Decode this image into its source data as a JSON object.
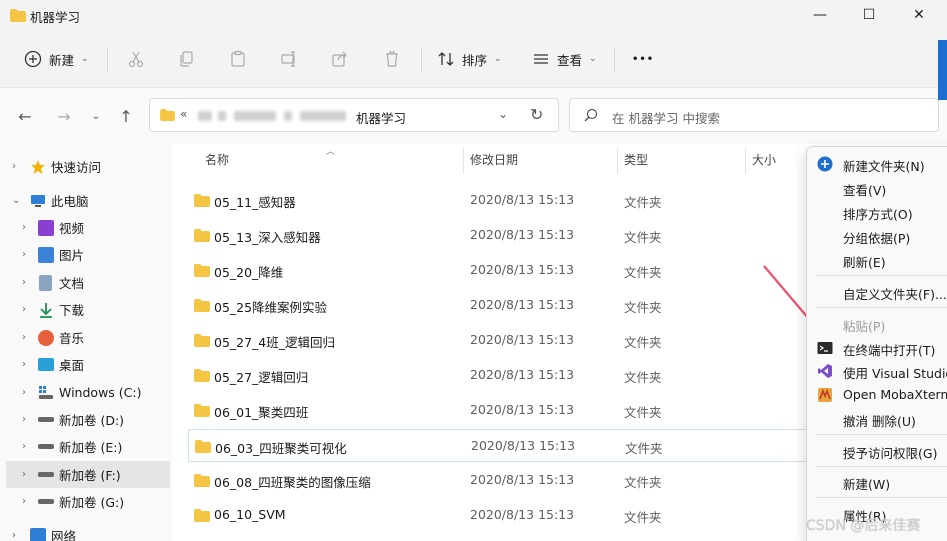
{
  "window": {
    "title": "机器学习",
    "controls": {
      "minimize": "—",
      "maximize": "☐",
      "close": "✕"
    }
  },
  "toolbar": {
    "new_label": "新建",
    "sort_label": "排序",
    "view_label": "查看",
    "more_label": "•••"
  },
  "address": {
    "prefix": "«",
    "current": "机器学习",
    "search_placeholder": "在 机器学习 中搜索"
  },
  "sidebar": {
    "items": [
      {
        "label": "快速访问",
        "icon": "star-icon"
      },
      {
        "label": "此电脑",
        "icon": "computer-icon"
      },
      {
        "label": "视频",
        "icon": "video-icon"
      },
      {
        "label": "图片",
        "icon": "picture-icon"
      },
      {
        "label": "文档",
        "icon": "document-icon"
      },
      {
        "label": "下载",
        "icon": "download-icon"
      },
      {
        "label": "音乐",
        "icon": "music-icon"
      },
      {
        "label": "桌面",
        "icon": "desktop-icon"
      },
      {
        "label": "Windows (C:)",
        "icon": "drive-c-icon"
      },
      {
        "label": "新加卷 (D:)",
        "icon": "drive-icon"
      },
      {
        "label": "新加卷 (E:)",
        "icon": "drive-icon"
      },
      {
        "label": "新加卷 (F:)",
        "icon": "drive-icon"
      },
      {
        "label": "新加卷 (G:)",
        "icon": "drive-icon"
      },
      {
        "label": "网络",
        "icon": "network-icon"
      }
    ]
  },
  "columns": {
    "name": "名称",
    "date": "修改日期",
    "type": "类型",
    "size": "大小"
  },
  "files": [
    {
      "name": "05_11_感知器",
      "date": "2020/8/13 15:13",
      "type": "文件夹"
    },
    {
      "name": "05_13_深入感知器",
      "date": "2020/8/13 15:13",
      "type": "文件夹"
    },
    {
      "name": "05_20_降维",
      "date": "2020/8/13 15:13",
      "type": "文件夹"
    },
    {
      "name": "05_25降维案例实验",
      "date": "2020/8/13 15:13",
      "type": "文件夹"
    },
    {
      "name": "05_27_4班_逻辑回归",
      "date": "2020/8/13 15:13",
      "type": "文件夹"
    },
    {
      "name": "05_27_逻辑回归",
      "date": "2020/8/13 15:13",
      "type": "文件夹"
    },
    {
      "name": "06_01_聚类四班",
      "date": "2020/8/13 15:13",
      "type": "文件夹"
    },
    {
      "name": "06_03_四班聚类可视化",
      "date": "2020/8/13 15:13",
      "type": "文件夹"
    },
    {
      "name": "06_08_四班聚类的图像压缩",
      "date": "2020/8/13 15:13",
      "type": "文件夹"
    },
    {
      "name": "06_10_SVM",
      "date": "2020/8/13 15:13",
      "type": "文件夹"
    }
  ],
  "context_menu": {
    "items": [
      {
        "label": "新建文件夹(N)",
        "icon": "new-folder-icon"
      },
      {
        "label": "查看(V)"
      },
      {
        "label": "排序方式(O)"
      },
      {
        "label": "分组依据(P)"
      },
      {
        "label": "刷新(E)"
      },
      {
        "label": "自定义文件夹(F)..."
      },
      {
        "label": "粘贴(P)"
      },
      {
        "label": "在终端中打开(T)",
        "icon": "terminal-icon"
      },
      {
        "label": "使用 Visual Studio",
        "icon": "visual-studio-icon"
      },
      {
        "label": "Open MobaXterm",
        "icon": "mobaxterm-icon"
      },
      {
        "label": "撤消 删除(U)"
      },
      {
        "label": "授予访问权限(G)"
      },
      {
        "label": "新建(W)"
      },
      {
        "label": "属性(R)"
      }
    ]
  },
  "watermark": "CSDN @后来佳赛",
  "colors": {
    "folder": "#f4c542",
    "accent": "#1c6fd1",
    "arrow": "#f0506e"
  }
}
